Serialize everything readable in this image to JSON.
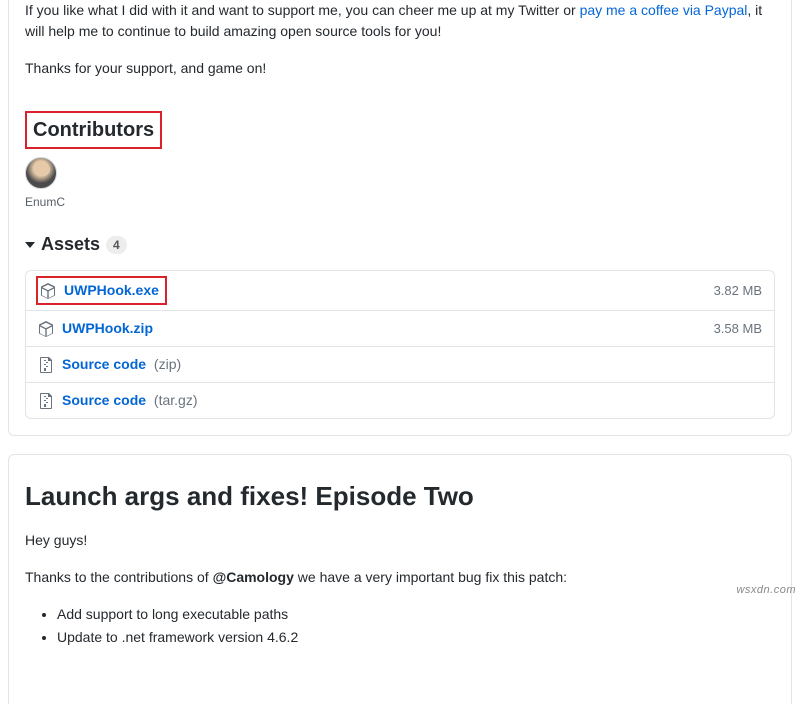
{
  "intro": {
    "line1_prefix": "If you like what I did with it and want to support me, you can cheer me up at my Twitter or ",
    "paypal_link": "pay me a coffee via Paypal",
    "line1_suffix": ", it will help me to continue to build amazing open source tools for you!",
    "thanks": "Thanks for your support, and game on!"
  },
  "contributors": {
    "heading": "Contributors",
    "items": [
      {
        "name": "EnumC"
      }
    ]
  },
  "assets": {
    "title": "Assets",
    "count": "4",
    "items": [
      {
        "name": "UWPHook.exe",
        "suffix": "",
        "size": "3.82 MB",
        "icon": "package-icon",
        "highlight": true
      },
      {
        "name": "UWPHook.zip",
        "suffix": "",
        "size": "3.58 MB",
        "icon": "package-icon",
        "highlight": false
      },
      {
        "name": "Source code",
        "suffix": "(zip)",
        "size": "",
        "icon": "zip-icon",
        "highlight": false
      },
      {
        "name": "Source code",
        "suffix": "(tar.gz)",
        "size": "",
        "icon": "zip-icon",
        "highlight": false
      }
    ]
  },
  "release2": {
    "title": "Launch args and fixes! Episode Two",
    "greeting": "Hey guys!",
    "thanks_prefix": "Thanks to the contributions of ",
    "mention": "@Camology",
    "thanks_suffix": " we have a very important bug fix this patch:",
    "changes": [
      "Add support to long executable paths",
      "Update to .net framework version 4.6.2"
    ]
  },
  "watermark": "wsxdn.com"
}
